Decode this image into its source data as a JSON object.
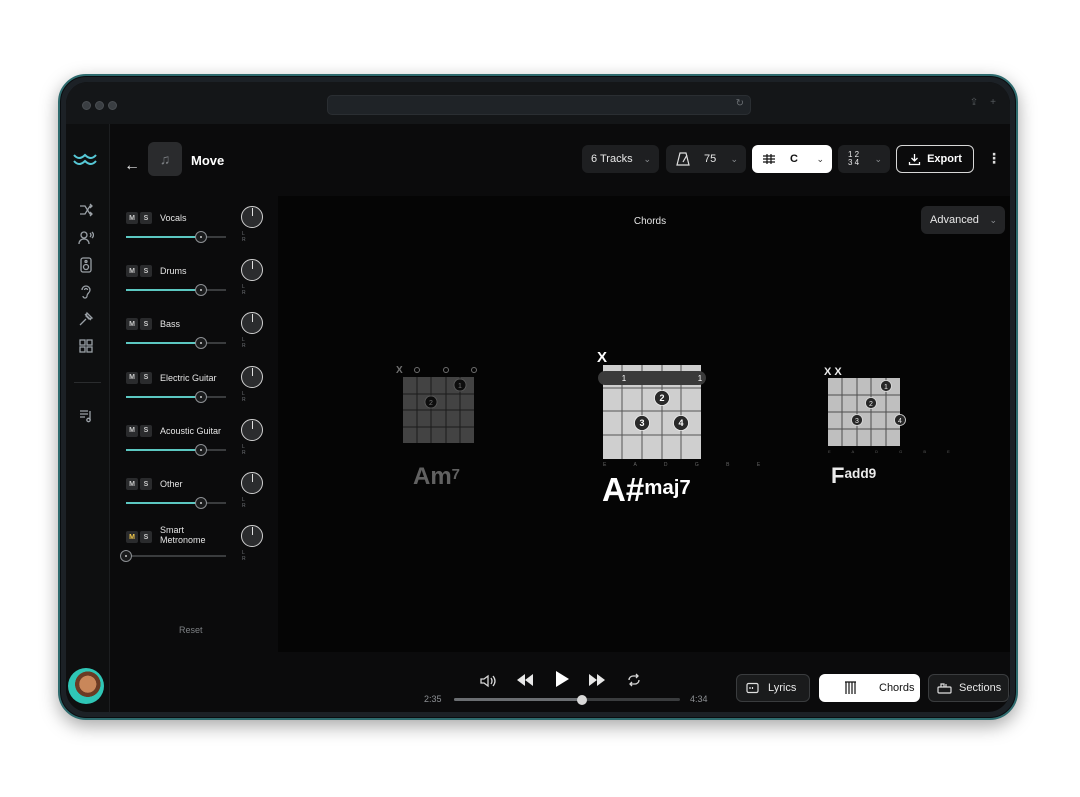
{
  "song": {
    "title": "Move"
  },
  "toolbar": {
    "tracks_label": "6 Tracks",
    "bpm": "75",
    "key": "C",
    "time_signature_top": "1 2",
    "time_signature_bottom": "3 4",
    "export_label": "Export"
  },
  "mixer": {
    "tracks": [
      {
        "name": "Vocals",
        "mute": "M",
        "solo": "S",
        "level": 0.75
      },
      {
        "name": "Drums",
        "mute": "M",
        "solo": "S",
        "level": 0.75
      },
      {
        "name": "Bass",
        "mute": "M",
        "solo": "S",
        "level": 0.75
      },
      {
        "name": "Electric Guitar",
        "mute": "M",
        "solo": "S",
        "level": 0.75
      },
      {
        "name": "Acoustic Guitar",
        "mute": "M",
        "solo": "S",
        "level": 0.75
      },
      {
        "name": "Other",
        "mute": "M",
        "solo": "S",
        "level": 0.75
      },
      {
        "name": "Smart Metronome",
        "mute": "M",
        "solo": "S",
        "level": 0.0,
        "mute_active": true
      }
    ],
    "pan_labels": "L R",
    "reset_label": "Reset"
  },
  "view": {
    "title": "Chords",
    "advanced_label": "Advanced"
  },
  "chords": [
    {
      "root": "Am",
      "quality": "7",
      "muted_strings": "X",
      "string_labels": "E A D G B E",
      "active": false
    },
    {
      "root": "A#",
      "quality": "maj7",
      "muted_strings": "X",
      "string_labels": "E A D G B E",
      "active": true
    },
    {
      "root": "F",
      "quality": "add9",
      "muted_strings": "X X",
      "string_labels": "E A D G B E",
      "active": false
    }
  ],
  "transport": {
    "current_time": "2:35",
    "total_time": "4:34",
    "progress": 0.566
  },
  "tabs": {
    "lyrics": "Lyrics",
    "chords": "Chords",
    "sections": "Sections"
  },
  "colors": {
    "accent": "#5cc8c2",
    "frame_border": "#2e6b6e",
    "background": "#0b0b0c",
    "mute_active": "#f2c94c"
  }
}
